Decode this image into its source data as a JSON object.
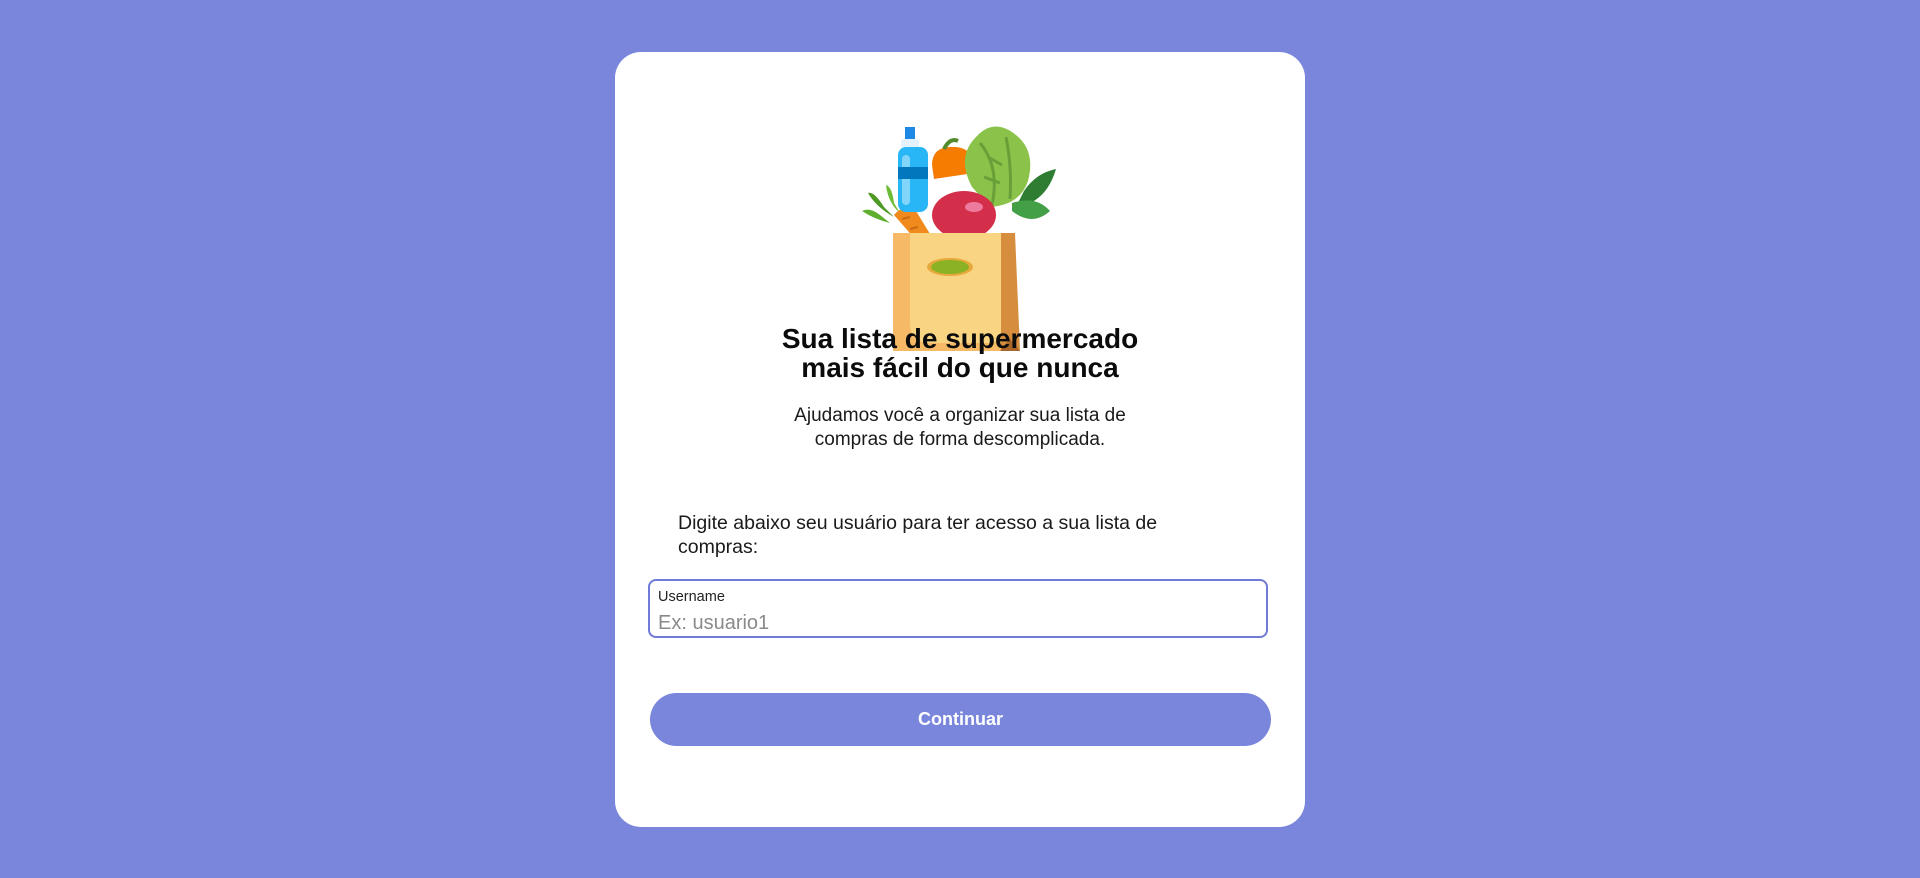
{
  "colors": {
    "background": "#7986dc",
    "card": "#ffffff",
    "accent": "#7986dc",
    "input_border": "#6f7bd6"
  },
  "hero": {
    "illustration_icon": "grocery-bag-icon",
    "title_line1": "Sua lista de supermercado",
    "title_line2": "mais fácil do que nunca",
    "subtitle_line1": "Ajudamos você a organizar sua lista de",
    "subtitle_line2": "compras de forma descomplicada."
  },
  "form": {
    "instruction": "Digite abaixo seu usuário para ter acesso a sua lista de compras:",
    "username_label": "Username",
    "username_placeholder": "Ex: usuario1",
    "username_value": "",
    "continue_label": "Continuar"
  }
}
